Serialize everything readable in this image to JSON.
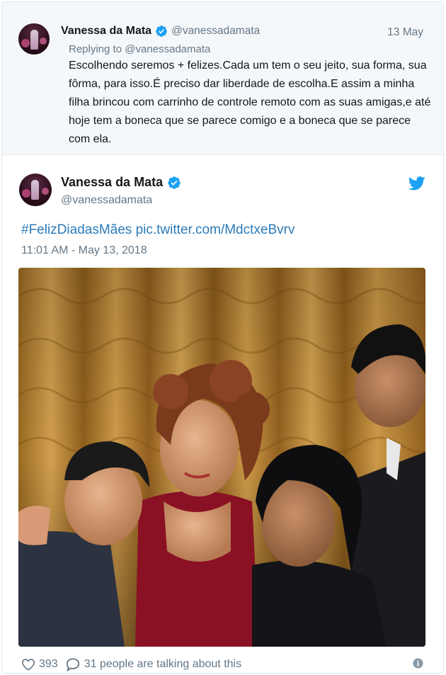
{
  "parent_tweet": {
    "name": "Vanessa da Mata",
    "handle": "@vanessadamata",
    "date": "13 May",
    "replying_label": "Replying to",
    "replying_handle": "@vanessadamata",
    "text": "Escolhendo seremos + felizes.Cada um tem o seu jeito, sua forma, sua fôrma, para isso.É preciso dar liberdade de escolha.E assim a minha filha brincou com carrinho de controle remoto com as suas amigas,e até hoje tem a boneca que se parece comigo e a boneca que se parece com ela."
  },
  "main_tweet": {
    "name": "Vanessa da Mata",
    "handle": "@vanessadamata",
    "hashtag": "#FelizDiadasMães",
    "link": "pic.twitter.com/MdctxeBvrv",
    "timestamp": "11:01 AM - May 13, 2018",
    "likes": "393",
    "conversation": "31 people are talking about this"
  },
  "colors": {
    "link": "#2b7bb9",
    "verified": "#1da1f2",
    "twitter_blue": "#1da1f2",
    "muted": "#657786",
    "curtain": "#b8842f"
  },
  "icons": [
    "verified-badge-icon",
    "twitter-bird-icon",
    "heart-icon",
    "reply-bubble-icon",
    "info-icon"
  ]
}
